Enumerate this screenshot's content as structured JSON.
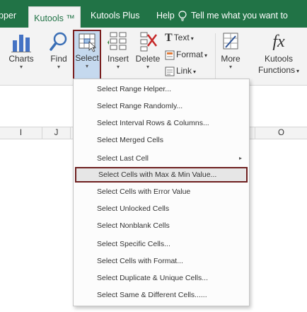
{
  "tabs": [
    "pper",
    "Kutools ™",
    "Kutools Plus",
    "Help"
  ],
  "tell_me": "Tell me what you want to",
  "ribbon": {
    "charts": "Charts",
    "find": "Find",
    "select": "Select",
    "insert": "Insert",
    "delete": "Delete",
    "text": "Text",
    "format": "Format",
    "link": "Link",
    "more": "More",
    "functions_line1": "Kutools",
    "functions_line2": "Functions",
    "fx_glyph": "fx",
    "caret": "▾"
  },
  "columns": [
    "I",
    "J",
    "",
    "O"
  ],
  "menu": {
    "items": [
      "Select Range Helper...",
      "Select Range Randomly...",
      "Select Interval Rows & Columns...",
      "Select Merged Cells",
      "Select Last Cell",
      "Select Cells with Max & Min Value...",
      "Select Cells with Error Value",
      "Select Unlocked Cells",
      "Select Nonblank Cells",
      "Select Specific Cells...",
      "Select Cells with Format...",
      "Select Duplicate & Unique Cells...",
      "Select Same & Different Cells......"
    ],
    "highlighted_index": 5,
    "submenu_arrow": "▸"
  },
  "colors": {
    "accent": "#217346",
    "highlight_border": "#6e1f1f"
  }
}
